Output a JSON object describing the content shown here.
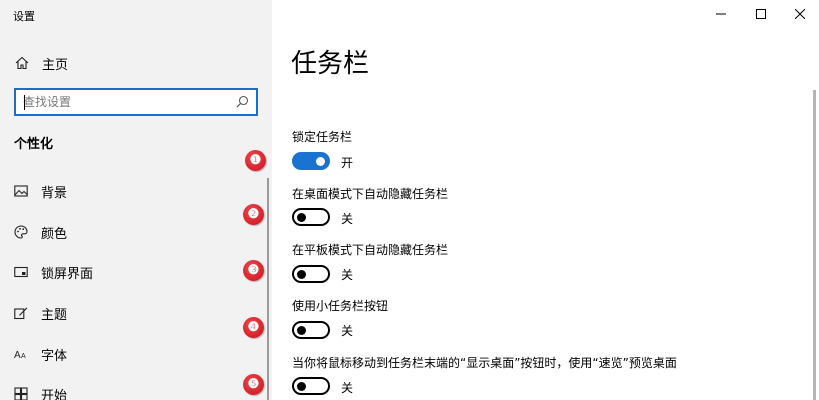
{
  "window": {
    "title": "设置",
    "minimize_icon": "minimize-icon",
    "maximize_icon": "maximize-icon",
    "close_icon": "close-icon"
  },
  "sidebar": {
    "home": {
      "label": "主页",
      "icon": "home-icon"
    },
    "search": {
      "placeholder": "查找设置",
      "icon": "search-icon"
    },
    "section_title": "个性化",
    "items": [
      {
        "label": "背景",
        "icon": "picture-icon"
      },
      {
        "label": "颜色",
        "icon": "palette-icon"
      },
      {
        "label": "锁屏界面",
        "icon": "lock-screen-icon"
      },
      {
        "label": "主题",
        "icon": "theme-brush-icon"
      },
      {
        "label": "字体",
        "icon": "font-icon"
      },
      {
        "label": "开始",
        "icon": "start-icon"
      }
    ]
  },
  "badges": [
    "❶",
    "❷",
    "❸",
    "❹",
    "❺"
  ],
  "main": {
    "title": "任务栏",
    "settings": [
      {
        "label": "锁定任务栏",
        "state": "开",
        "on": true
      },
      {
        "label": "在桌面模式下自动隐藏任务栏",
        "state": "关",
        "on": false
      },
      {
        "label": "在平板模式下自动隐藏任务栏",
        "state": "关",
        "on": false
      },
      {
        "label": "使用小任务栏按钮",
        "state": "关",
        "on": false
      },
      {
        "label": "当你将鼠标移动到任务栏末端的“显示桌面”按钮时，使用“速览”预览桌面",
        "state": "关",
        "on": false
      }
    ]
  },
  "colors": {
    "accent": "#1a73d1",
    "sidebar_bg": "#f2f2f2",
    "badge_red": "#d9232b"
  }
}
